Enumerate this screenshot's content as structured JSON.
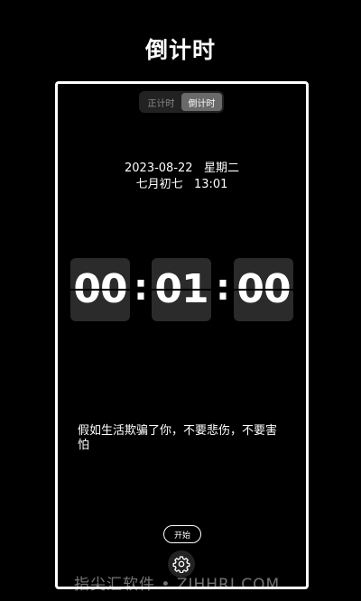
{
  "header": {
    "title": "倒计时"
  },
  "mode_toggle": {
    "options": [
      "正计时",
      "倒计时"
    ],
    "selected": "倒计时"
  },
  "date_info": {
    "line1": "2023-08-22   星期二",
    "line2": "七月初七   13:01"
  },
  "timer": {
    "hours": "00",
    "minutes": "01",
    "seconds": "00",
    "separator": ":"
  },
  "quote": {
    "text": "假如生活欺骗了你，不要悲伤，不要害怕"
  },
  "controls": {
    "start_label": "开始",
    "settings_icon": "gear-icon"
  },
  "watermark": {
    "text": "指尖汇软件 • ZIHHRI.COM"
  },
  "colors": {
    "background": "#000000",
    "frame_border": "#ffffff",
    "digit_box": "#2b2b2b",
    "toggle_active": "#6a6a6a"
  }
}
